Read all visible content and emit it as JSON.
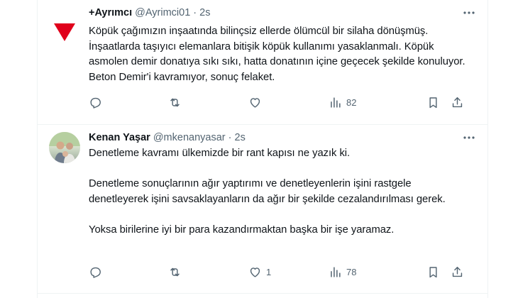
{
  "tweets": [
    {
      "name": "+Ayrımcı",
      "handle": "@Ayrimci01",
      "dot": "·",
      "time": "2s",
      "text": "Köpük çağımızın inşaatında bilinçsiz ellerde ölümcül bir silaha dönüşmüş.\nİnşaatlarda taşıyıcı elemanlara bitişik köpük kullanımı yasaklanmalı. Köpük asmolen demir donatıya sıkı sıkı, hatta donatının içine geçecek şekilde konuluyor. Beton Demir'i kavramıyor, sonuç felaket.",
      "likes": "",
      "views": "82"
    },
    {
      "name": "Kenan Yaşar",
      "handle": "@mkenanyasar",
      "dot": "·",
      "time": "2s",
      "text": "Denetleme kavramı ülkemizde bir rant kapısı ne yazık ki.\n\nDenetleme sonuçlarının ağır yaptırımı ve denetleyenlerin işini rastgele denetleyerek işini savsaklayanların da ağır bir şekilde cezalandırılması gerek.\n\nYoksa birilerine iyi bir para kazandırmaktan başka bir işe yaramaz.",
      "likes": "1",
      "views": "78"
    }
  ],
  "icons": {
    "avatar1": "red-triangle-logo",
    "more": "more-horizontal-icon",
    "reply": "reply-icon",
    "retweet": "retweet-icon",
    "like": "like-icon",
    "views": "views-icon",
    "bookmark": "bookmark-icon",
    "share": "share-icon"
  },
  "colors": {
    "text": "#0f1419",
    "secondary": "#536471",
    "divider": "#eff3f4",
    "logo_red": "#e0001b"
  }
}
